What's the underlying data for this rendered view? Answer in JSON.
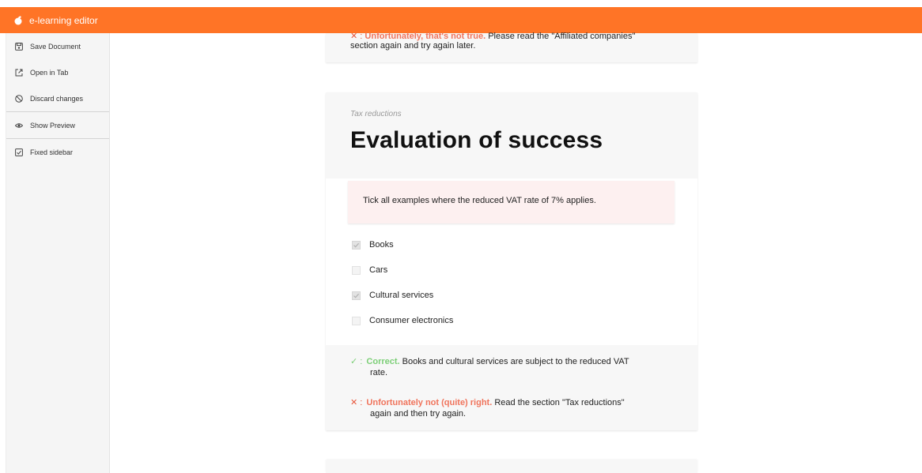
{
  "app": {
    "title": "e-learning editor"
  },
  "sidebar": {
    "items": [
      {
        "label": "Save Document",
        "icon": "save-icon"
      },
      {
        "label": "Open in Tab",
        "icon": "open-in-new-icon"
      },
      {
        "label": "Discard changes",
        "icon": "block-icon"
      },
      {
        "label": "Show Preview",
        "icon": "eye-icon"
      },
      {
        "label": "Fixed sidebar",
        "icon": "checkbox-icon",
        "checked": true
      }
    ]
  },
  "previous_card": {
    "line1_symbol": "✕ :",
    "line1_highlight": "Unfortunately, that's not true.",
    "line1_rest": " Please read the \"Affiliated companies\"",
    "line2": "section again and try again later."
  },
  "card": {
    "subtitle": "Tax reductions",
    "title": "Evaluation of success",
    "question": "Tick all examples where the reduced VAT rate of 7% applies.",
    "options": [
      {
        "label": "Books",
        "checked": true
      },
      {
        "label": "Cars",
        "checked": false
      },
      {
        "label": "Cultural services",
        "checked": true
      },
      {
        "label": "Consumer electronics",
        "checked": false
      }
    ],
    "feedback": {
      "correct": {
        "symbol": "✓ :",
        "highlight": "Correct.",
        "text_line1": " Books and cultural services are subject to the reduced VAT",
        "text_line2": "rate."
      },
      "incorrect": {
        "symbol": "✕ :",
        "highlight": "Unfortunately not (quite) right.",
        "text_line1": " Read the section \"Tax reductions\"",
        "text_line2": "again and then try again."
      }
    }
  },
  "colors": {
    "accent": "#ff7426",
    "correct": "#7ccf77",
    "incorrect": "#f0745c",
    "question_bg": "#fdf0f0"
  }
}
